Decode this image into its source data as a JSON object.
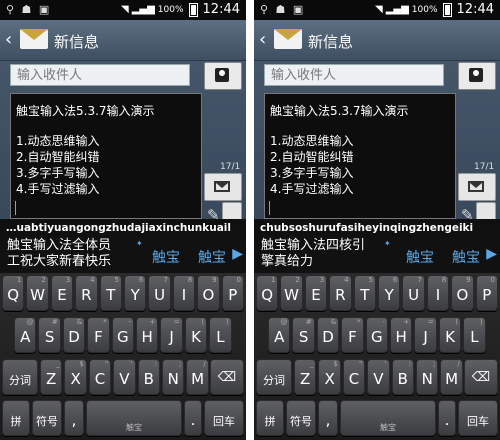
{
  "status_bar": {
    "battery": "100%",
    "time": "12:44",
    "icons": [
      "usb-icon",
      "android-icon",
      "image-icon",
      "wifi-icon",
      "signal-icon",
      "battery-icon"
    ]
  },
  "header": {
    "title": "新信息"
  },
  "compose": {
    "recipient_placeholder": "输入收件人",
    "message_lines": [
      "触宝输入法5.3.7输入演示",
      "",
      "1.动态思维输入",
      "2.自动智能纠错",
      "3.多字手写输入",
      "4.手写过滤输入"
    ],
    "char_counter": "17/1"
  },
  "screens": [
    {
      "pinyin": "…uabtiyuangongzhudajiaxinchunkuail",
      "main_candidate": [
        "触宝输入法全体员",
        "工祝大家新春快乐"
      ],
      "candidates": [
        "触宝",
        "触宝"
      ]
    },
    {
      "pinyin": "chubsoshurufasiheyinqingzhengeiki",
      "main_candidate": [
        "触宝输入法四核引",
        "擎真给力"
      ],
      "candidates": [
        "触宝",
        "触宝"
      ]
    }
  ],
  "keyboard": {
    "row1": [
      {
        "k": "Q",
        "h": "1"
      },
      {
        "k": "W",
        "h": "2"
      },
      {
        "k": "E",
        "h": "3"
      },
      {
        "k": "R",
        "h": "4"
      },
      {
        "k": "T",
        "h": "5"
      },
      {
        "k": "Y",
        "h": "6"
      },
      {
        "k": "U",
        "h": "7"
      },
      {
        "k": "I",
        "h": "8"
      },
      {
        "k": "O",
        "h": "9"
      },
      {
        "k": "P",
        "h": "0"
      }
    ],
    "row2": [
      {
        "k": "A",
        "h": "@"
      },
      {
        "k": "S",
        "h": "#"
      },
      {
        "k": "D",
        "h": "&"
      },
      {
        "k": "F",
        "h": "*"
      },
      {
        "k": "G",
        "h": "-"
      },
      {
        "k": "H",
        "h": "+"
      },
      {
        "k": "J",
        "h": "="
      },
      {
        "k": "K",
        "h": "("
      },
      {
        "k": "L",
        "h": ")"
      }
    ],
    "row3": [
      {
        "k": "Z",
        "h": "_"
      },
      {
        "k": "X",
        "h": "$"
      },
      {
        "k": "C",
        "h": "\""
      },
      {
        "k": "V",
        "h": "'"
      },
      {
        "k": "B",
        "h": ":"
      },
      {
        "k": "N",
        "h": ";"
      },
      {
        "k": "M",
        "h": "/"
      }
    ],
    "segment": "分词",
    "backspace": "⌫",
    "pinyin_key": "拼",
    "symbols": "符号",
    "comma": ",",
    "space": "触宝",
    "period": ".",
    "enter": "回车",
    "mic": "🎤"
  },
  "colors": {
    "accent": "#58a8e8",
    "header_top": "#5d6f82",
    "header_bottom": "#3e4f61",
    "key_top": "#5f6063",
    "key_bottom": "#3b3c3f"
  }
}
